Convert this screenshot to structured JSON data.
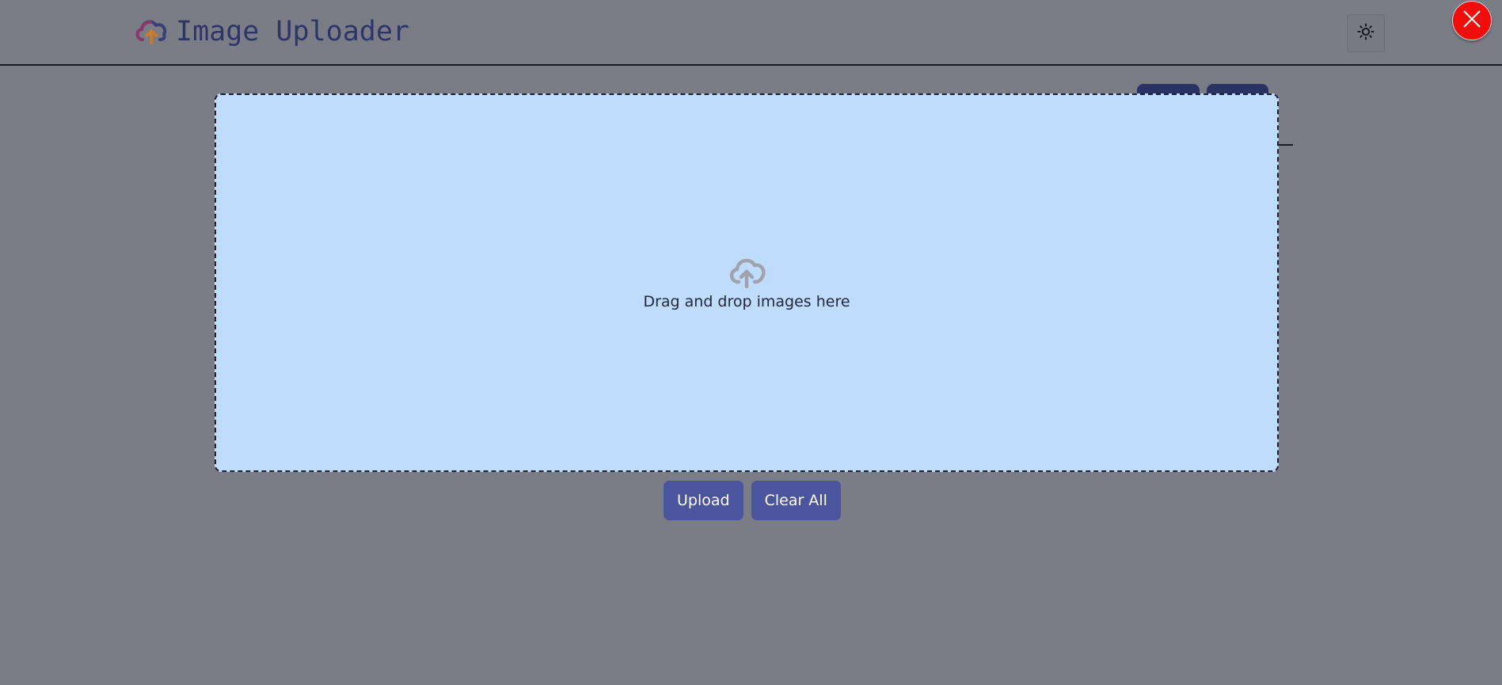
{
  "header": {
    "title": "Image Uploader",
    "logo_icon": "cloud-upload-icon",
    "theme_toggle_icon": "sun-icon"
  },
  "close_button": {
    "icon": "close-icon",
    "color": "#f20d0d"
  },
  "dropzone": {
    "icon": "cloud-upload-icon",
    "text": "Drag and drop images here",
    "background": "#c0dcfc"
  },
  "actions": {
    "upload_label": "Upload",
    "clear_label": "Clear All"
  },
  "colors": {
    "page_background": "#7a7d86",
    "accent": "#4b559e",
    "title": "#2f3566"
  }
}
